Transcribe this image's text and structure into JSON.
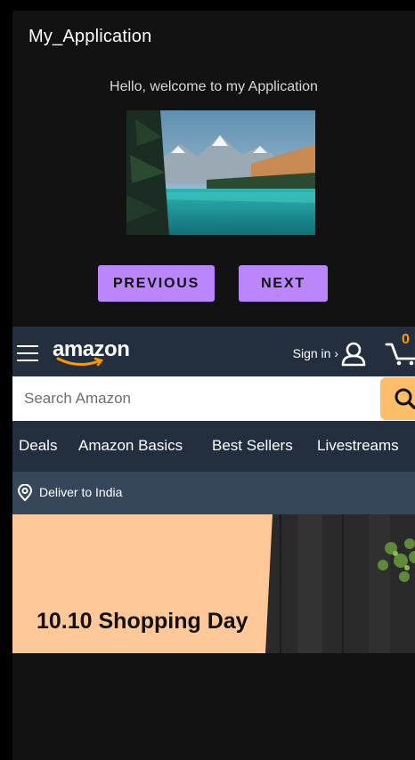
{
  "app": {
    "title": "My_Application",
    "welcome_text": "Hello, welcome to my Application",
    "image_icon": "landscape-photo",
    "buttons": {
      "previous": "PREVIOUS",
      "next": "NEXT"
    },
    "accent_color": "#bb86fc"
  },
  "amazon": {
    "logo_text": "amazon",
    "sign_in": "Sign in ›",
    "cart_count": "0",
    "search": {
      "placeholder": "Search Amazon",
      "value": ""
    },
    "nav_items": [
      "Deals",
      "Amazon Basics",
      "Best Sellers",
      "Livestreams"
    ],
    "deliver_text": "Deliver to India",
    "hero_title": "10.10 Shopping Day",
    "colors": {
      "header": "#232f3e",
      "subheader": "#37475a",
      "accent": "#febd69",
      "hero_bg": "#ffc898"
    },
    "icons": {
      "menu": "hamburger-menu-icon",
      "account": "user-icon",
      "cart": "cart-icon",
      "search": "search-icon",
      "location": "location-pin-icon"
    }
  }
}
